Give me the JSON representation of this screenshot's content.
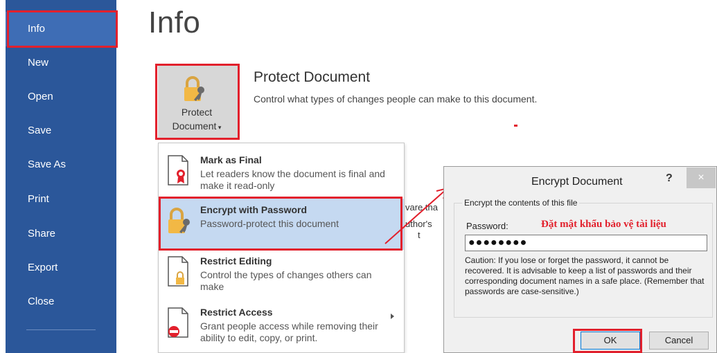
{
  "sidebar": {
    "items": [
      {
        "label": "Info"
      },
      {
        "label": "New"
      },
      {
        "label": "Open"
      },
      {
        "label": "Save"
      },
      {
        "label": "Save As"
      },
      {
        "label": "Print"
      },
      {
        "label": "Share"
      },
      {
        "label": "Export"
      },
      {
        "label": "Close"
      }
    ]
  },
  "page": {
    "title": "Info"
  },
  "protect": {
    "button_line1": "Protect",
    "button_line2": "Document",
    "section_title": "Protect Document",
    "section_desc": "Control what types of changes people can make to this document."
  },
  "menu": {
    "items": [
      {
        "title": "Mark as Final",
        "desc": "Let readers know the document is final and make it read-only"
      },
      {
        "title": "Encrypt with Password",
        "desc": "Password-protect this document"
      },
      {
        "title": "Restrict Editing",
        "desc": "Control the types of changes others can make"
      },
      {
        "title": "Restrict Access",
        "desc": "Grant people access while removing their ability to edit, copy, or print."
      }
    ]
  },
  "behind": {
    "line1": "vare tha",
    "line2": "uthor's",
    "line3": "t"
  },
  "dialog": {
    "title": "Encrypt Document",
    "help": "?",
    "close": "×",
    "group_label": "Encrypt the contents of this file",
    "password_label": "Password:",
    "password_note": "Đặt mật khẩu bảo vệ tài liệu",
    "password_value": "●●●●●●●●",
    "caution": "Caution: If you lose or forget the password, it cannot be recovered. It is advisable to keep a list of passwords and their corresponding document names in a safe place. (Remember that passwords are case-sensitive.)",
    "ok_label": "OK",
    "cancel_label": "Cancel"
  },
  "colors": {
    "sidebar_bg": "#2b579a",
    "highlight_red": "#e2202c",
    "menu_hover": "#c5d9f1"
  }
}
